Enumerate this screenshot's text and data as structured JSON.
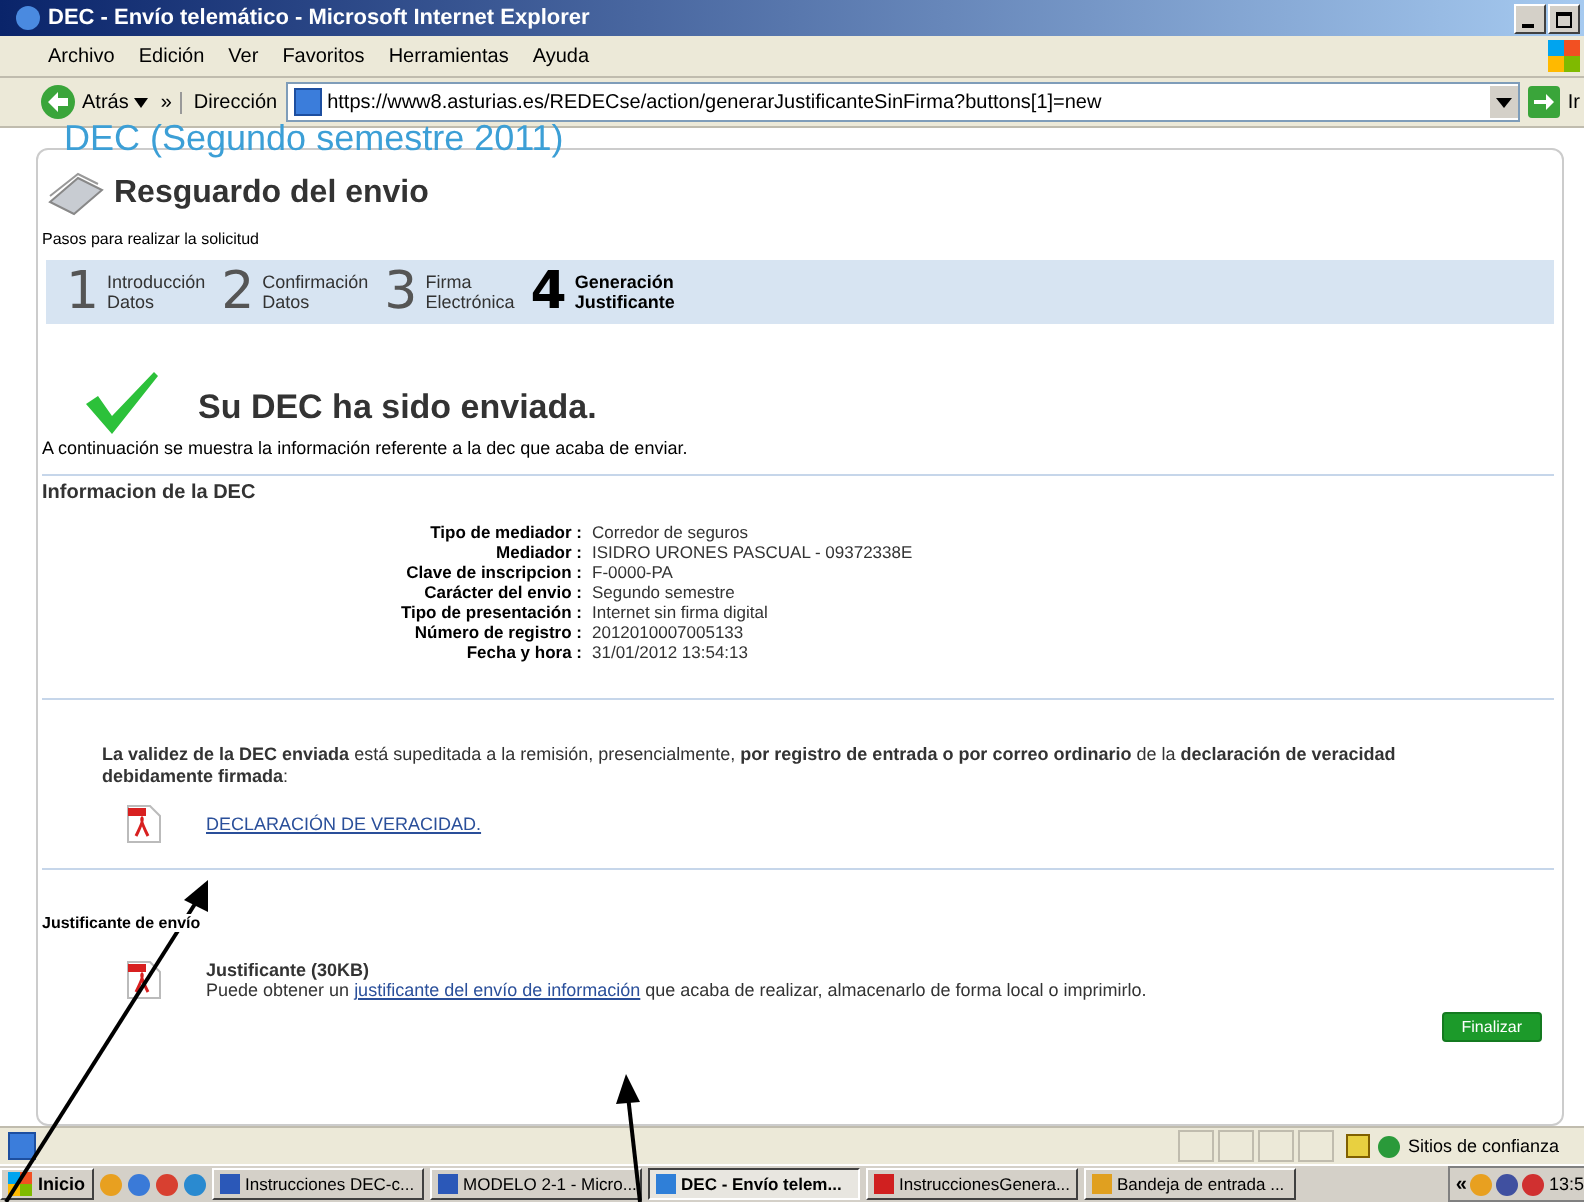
{
  "window": {
    "title": "DEC - Envío telemático - Microsoft Internet Explorer"
  },
  "menu": [
    "Archivo",
    "Edición",
    "Ver",
    "Favoritos",
    "Herramientas",
    "Ayuda"
  ],
  "toolbar": {
    "back": "Atrás",
    "chevron": "»",
    "address_label": "Dirección",
    "url": "https://www8.asturias.es/REDECse/action/generarJustificanteSinFirma?buttons[1]=new",
    "go": "Ir"
  },
  "page": {
    "header": "DEC (Segundo semestre 2011)",
    "title": "Resguardo del envio",
    "steps_caption": "Pasos para realizar la solicitud",
    "steps": [
      {
        "number": "1",
        "line1": "Introducción",
        "line2": "Datos",
        "selected": false
      },
      {
        "number": "2",
        "line1": "Confirmación",
        "line2": "Datos",
        "selected": false
      },
      {
        "number": "3",
        "line1": "Firma",
        "line2": "Electrónica",
        "selected": false
      },
      {
        "number": "4",
        "line1": "Generación",
        "line2": "Justificante",
        "selected": true
      }
    ],
    "success_title": "Su DEC ha sido enviada.",
    "success_message": "A continuación se muestra la información referente a la dec que acaba de enviar.",
    "info_title": "Informacion de la DEC",
    "fields": [
      {
        "label": "Tipo de mediador :",
        "value": "Corredor de seguros"
      },
      {
        "label": "Mediador :",
        "value": "ISIDRO  URONES  PASCUAL - 09372338E"
      },
      {
        "label": "Clave de inscripcion :",
        "value": "F-0000-PA"
      },
      {
        "label": "Carácter del envio :",
        "value": "Segundo semestre"
      },
      {
        "label": "Tipo de presentación :",
        "value": "Internet sin firma digital"
      },
      {
        "label": "Número de registro :",
        "value": "2012010007005133"
      },
      {
        "label": "Fecha y hora :",
        "value": "31/01/2012 13:54:13"
      }
    ],
    "notice": "**La validez de la DEC enviada** está supeditada a la remisión, presencialmente, **por registro de entrada o por correo ordinario** de la **declaración de veracidad debidamente firmada**:",
    "declaration_link": "DECLARACIÓN DE VERACIDAD.",
    "receipt_title": "Justificante de envío",
    "receipt_file": "Justificante (30KB)",
    "receipt_before": "Puede obtener un",
    "receipt_link": "justificante del envío de información",
    "receipt_after": "que acaba de realizar, almacenarlo de forma local o imprimirlo.",
    "finish": "Finalizar"
  },
  "status_bar": {
    "zone": "Sitios de confianza"
  },
  "taskbar": {
    "start": "Inicio",
    "tasks": [
      {
        "label": "Instrucciones DEC-c...",
        "kind": "word",
        "selected": false
      },
      {
        "label": "MODELO 2-1 - Micro...",
        "kind": "word",
        "selected": false
      },
      {
        "label": "DEC - Envío telem...",
        "kind": "browser",
        "selected": true
      },
      {
        "label": "InstruccionesGenera...",
        "kind": "pdf",
        "selected": false
      },
      {
        "label": "Bandeja de entrada ...",
        "kind": "mail",
        "selected": false
      }
    ],
    "tray_toggle": "«",
    "clock": "13:5"
  }
}
